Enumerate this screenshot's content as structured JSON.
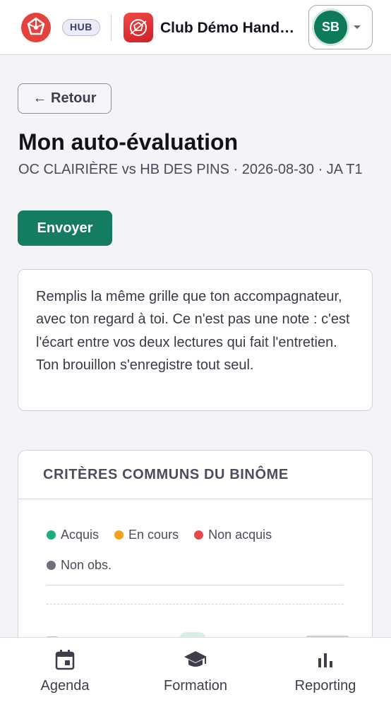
{
  "header": {
    "hub_badge": "HUB",
    "club_name": "Club Démo HandA…",
    "user_initials": "SB"
  },
  "page": {
    "back_label": "← Retour",
    "title": "Mon auto-évaluation",
    "subtitle": "OC CLAIRIÈRE vs HB DES PINS · 2026-08-30 · JA T1",
    "send_label": "Envoyer",
    "info_text": "Remplis la même grille que ton accompagnateur, avec ton regard à toi. Ce n'est pas une note : c'est l'écart entre vos deux lectures qui fait l'entretien. Ton brouillon s'enregistre tout seul."
  },
  "criteria": {
    "title": "CRITÈRES COMMUNS DU BINÔME",
    "legend": [
      {
        "label": "Acquis",
        "color": "#1aae7a"
      },
      {
        "label": "En cours",
        "color": "#f4a11c"
      },
      {
        "label": "Non acquis",
        "color": "#e5484d"
      },
      {
        "label": "Non obs.",
        "color": "#6e6e80"
      }
    ]
  },
  "nav": {
    "items": [
      {
        "label": "Agenda",
        "icon": "calendar-icon"
      },
      {
        "label": "Formation",
        "icon": "graduation-cap-icon"
      },
      {
        "label": "Reporting",
        "icon": "bar-chart-icon"
      }
    ]
  }
}
